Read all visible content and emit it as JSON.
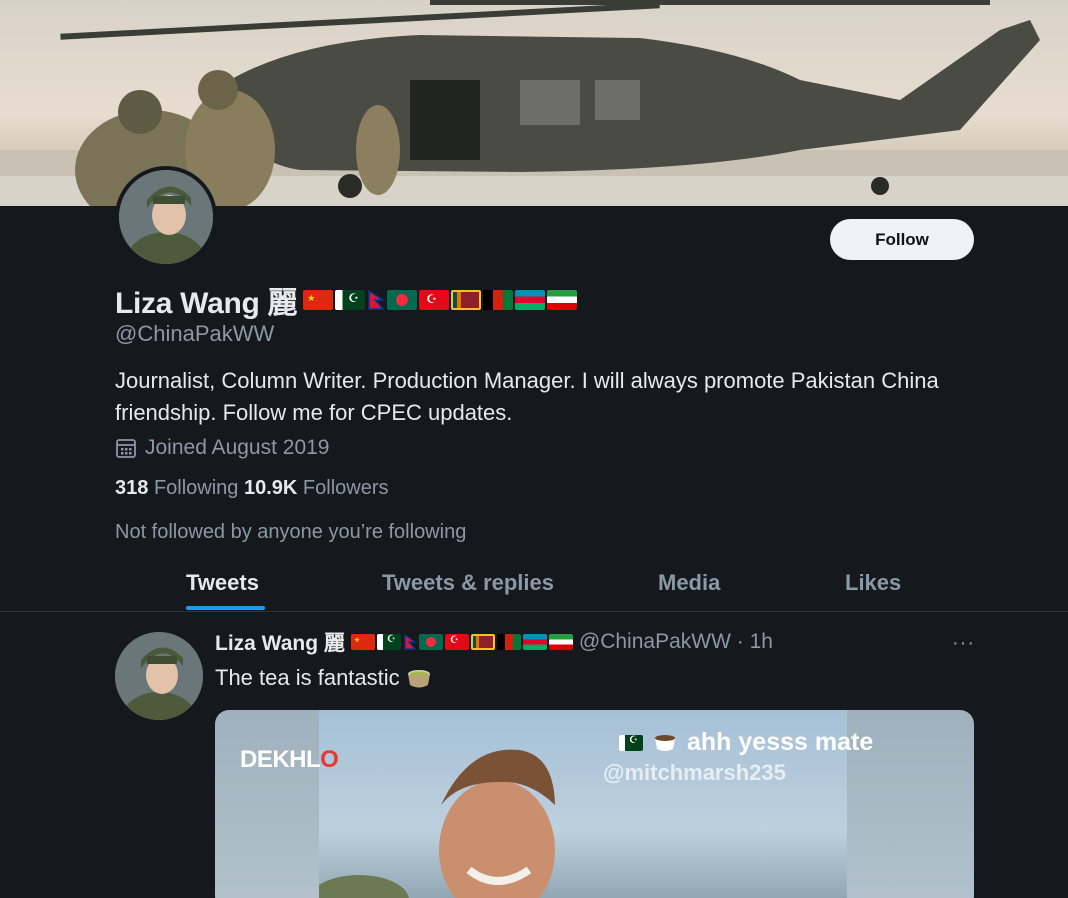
{
  "profile": {
    "display_name": "Liza Wang 麗",
    "handle": "@ChinaPakWW",
    "bio": "Journalist, Column Writer. Production Manager. I will always promote Pakistan China friendship. Follow me for CPEC updates.",
    "joined": "Joined August 2019",
    "following_count": "318",
    "following_label": "Following",
    "followers_count": "10.9K",
    "followers_label": "Followers",
    "followed_by": "Not followed by anyone you’re following",
    "follow_button": "Follow",
    "flags": [
      "china-flag",
      "pakistan-flag",
      "nepal-flag",
      "bangladesh-flag",
      "turkey-flag",
      "sri-lanka-flag",
      "afghanistan-flag",
      "azerbaijan-flag",
      "iran-flag"
    ]
  },
  "tabs": [
    {
      "label": "Tweets",
      "active": true
    },
    {
      "label": "Tweets & replies",
      "active": false
    },
    {
      "label": "Media",
      "active": false
    },
    {
      "label": "Likes",
      "active": false
    }
  ],
  "tweet": {
    "name": "Liza Wang 麗",
    "handle": "@ChinaPakWW · 1h",
    "text": "The tea is fantastic",
    "text_icon": "tea-cup-icon",
    "more": "···",
    "media": {
      "logo_text": "DEKHL",
      "logo_tail": "O",
      "overlay_text": "ahh yesss mate",
      "overlay_sub": "@mitchmarsh235"
    }
  },
  "colors": {
    "background": "#15181c",
    "accent": "#1d9bf0",
    "text_primary": "#e7e9ea",
    "text_secondary": "#8b98a5"
  }
}
